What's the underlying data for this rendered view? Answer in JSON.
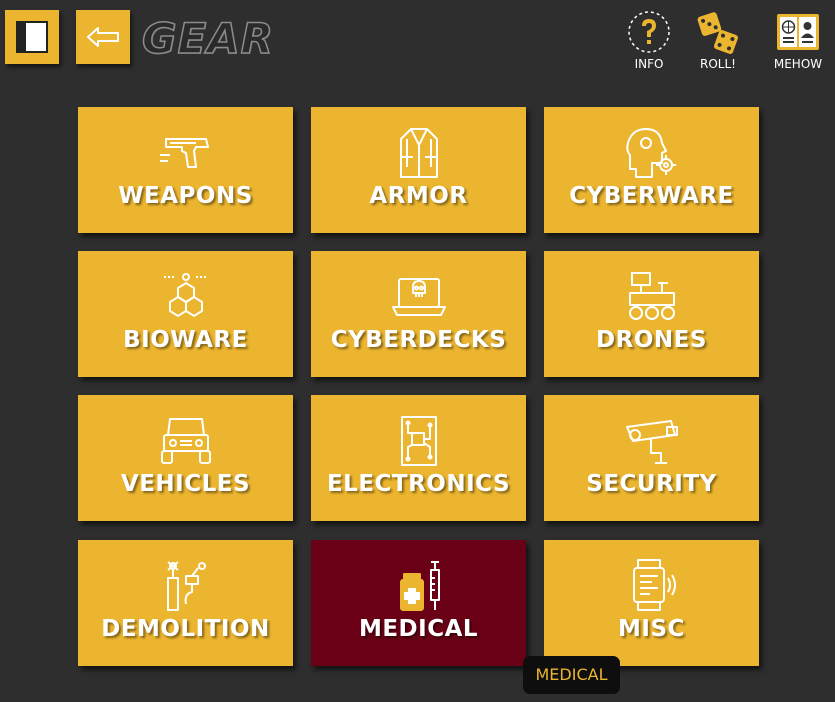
{
  "header": {
    "title": "GEAR",
    "menu_icon": "panel-icon",
    "back_icon": "left-arrow-icon"
  },
  "toolbar": {
    "info_label": "INFO",
    "roll_label": "ROLL!",
    "mehow_label": "MEHOW"
  },
  "categories": [
    {
      "label": "WEAPONS",
      "icon": "pistol-icon"
    },
    {
      "label": "ARMOR",
      "icon": "jacket-icon"
    },
    {
      "label": "CYBERWARE",
      "icon": "cyber-head-icon"
    },
    {
      "label": "BIOWARE",
      "icon": "molecule-icon"
    },
    {
      "label": "CYBERDECKS",
      "icon": "laptop-skull-icon"
    },
    {
      "label": "DRONES",
      "icon": "robot-rover-icon"
    },
    {
      "label": "VEHICLES",
      "icon": "jeep-icon"
    },
    {
      "label": "ELECTRONICS",
      "icon": "circuit-board-icon"
    },
    {
      "label": "SECURITY",
      "icon": "security-camera-icon"
    },
    {
      "label": "DEMOLITION",
      "icon": "explosive-icon"
    },
    {
      "label": "MEDICAL",
      "icon": "syringe-bottle-icon",
      "active": true
    },
    {
      "label": "MISC",
      "icon": "smartwatch-icon"
    }
  ],
  "tooltip": "MEDICAL",
  "colors": {
    "background": "#2e2e2f",
    "accent": "#ecb52f",
    "active": "#6a0016",
    "tooltip_bg": "#0e0e0e"
  }
}
